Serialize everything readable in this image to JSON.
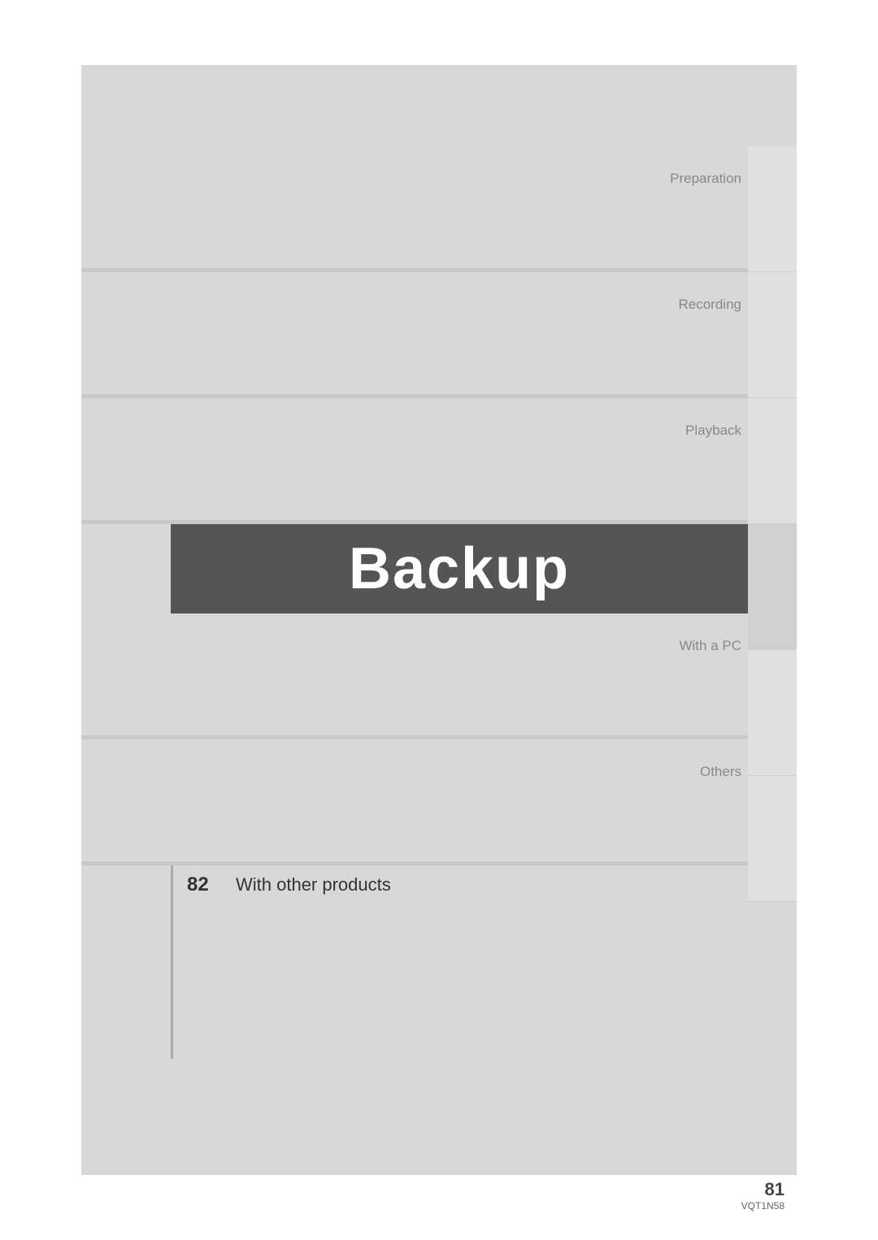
{
  "page": {
    "background_color": "#d8d8d8",
    "sections": [
      {
        "id": "preparation",
        "label": "Preparation"
      },
      {
        "id": "recording",
        "label": "Recording"
      },
      {
        "id": "playback",
        "label": "Playback"
      },
      {
        "id": "backup",
        "label": "Backup"
      },
      {
        "id": "withpc",
        "label": "With a PC"
      },
      {
        "id": "others",
        "label": "Others"
      }
    ],
    "backup_title": "Backup",
    "entries": [
      {
        "number": "82",
        "text": "With other products"
      }
    ],
    "page_number": "81",
    "model_number": "VQT1N58"
  }
}
